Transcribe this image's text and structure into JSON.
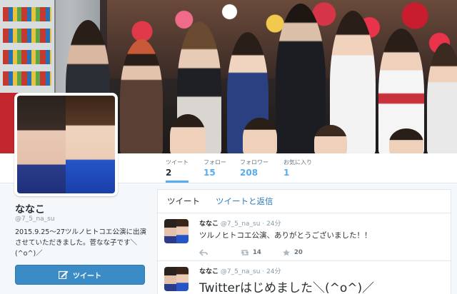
{
  "profile": {
    "name": "ななこ",
    "handle": "@7_5_na_su",
    "bio": "2015.9.25〜27ツルノヒトコエ公演に出演させていただきました。菅なな子です＼(^o^)／",
    "tweet_button_label": "ツイート"
  },
  "stats": [
    {
      "label": "ツイート",
      "value": "2",
      "active": true
    },
    {
      "label": "フォロー",
      "value": "15",
      "active": false
    },
    {
      "label": "フォロワー",
      "value": "208",
      "active": false
    },
    {
      "label": "お気に入り",
      "value": "1",
      "active": false
    }
  ],
  "timeline": {
    "tabs": [
      {
        "label": "ツイート",
        "active": true
      },
      {
        "label": "ツイートと返信",
        "active": false
      }
    ],
    "tweets": [
      {
        "name": "ななこ",
        "handle": "@7_5_na_su",
        "time": "· 24分",
        "text": "ツルノヒトコエ公演、ありがとうございました！！",
        "retweets": "14",
        "favorites": "20"
      },
      {
        "name": "ななこ",
        "handle": "@7_5_na_su",
        "time": "· 24分",
        "text": "Twitterはじめました＼(^o^)／"
      }
    ]
  },
  "colors": {
    "accent": "#55acee",
    "button": "#3b8bc7",
    "link": "#2b7bb9"
  }
}
